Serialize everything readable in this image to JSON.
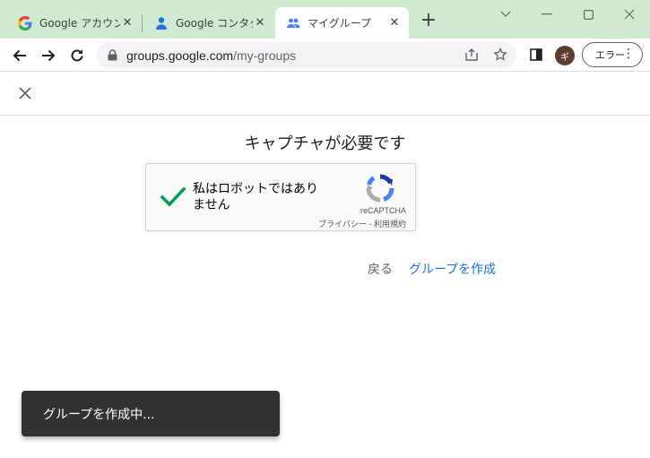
{
  "browser": {
    "tabs": [
      {
        "title": "Google アカウント",
        "icon": "google-g-icon",
        "active": false
      },
      {
        "title": "Google コンタクト",
        "icon": "contacts-person-icon",
        "active": false
      },
      {
        "title": "マイグループ",
        "icon": "groups-people-icon",
        "active": true
      }
    ],
    "address": {
      "host": "groups.google.com",
      "path": "/my-groups"
    },
    "profile_initial": "ギ",
    "error_chip_label": "エラー"
  },
  "page": {
    "captcha_title": "キャプチャが必要です",
    "recaptcha": {
      "label": "私はロボットではありません",
      "brand": "reCAPTCHA",
      "terms": "プライバシー - 利用規約",
      "checked": true
    },
    "back_label": "戻る",
    "create_group_label": "グループを作成"
  },
  "snackbar": {
    "message": "グループを作成中..."
  },
  "colors": {
    "tabstrip": "#cfeacf",
    "link": "#1a73e8",
    "check": "#009e55",
    "snackbar": "#323232"
  }
}
